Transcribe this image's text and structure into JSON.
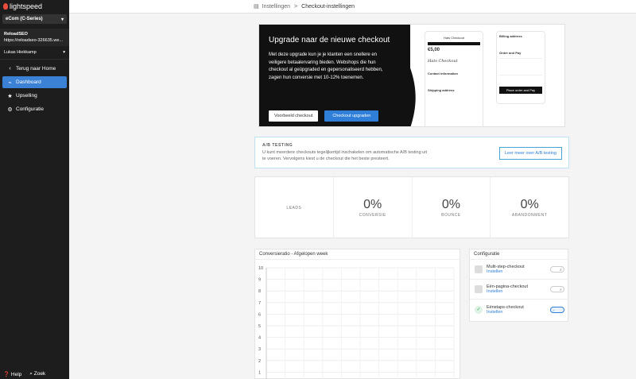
{
  "sidebar": {
    "logo_text": "lightspeed",
    "store_select": "eCom (C-Series)",
    "shop_name": "ReloadSEO",
    "shop_url": "https://reloadseo-326635.we...",
    "user_name": "Lukas Hiekkamp",
    "nav": [
      {
        "label": "Terug naar Home",
        "icon": "chevron-left"
      },
      {
        "label": "Dashboard",
        "icon": "chart"
      },
      {
        "label": "Upselling",
        "icon": "star"
      },
      {
        "label": "Configuratie",
        "icon": "gear"
      }
    ],
    "footer_help": "Help",
    "footer_search": "Zoek"
  },
  "breadcrumb": {
    "parent": "Instellingen",
    "separator": ">",
    "current": "Checkout-instellingen"
  },
  "banner": {
    "title": "Upgrade naar de nieuwe checkout",
    "text": "Met deze upgrade kun je je klanten een snellere en veiligere betaalervaring bieden. Webshops die hun checkout al geüpgraded en gepersonaliseerd hebben, zagen hun conversie met 10-12% toenemen.",
    "btn_example": "Voorbeeld checkout",
    "btn_upgrade": "Checkout upgraden",
    "phone1": {
      "header": "Hats Checkout",
      "price": "€5,00",
      "signature": "Hats Checkout",
      "contact": "Contact information",
      "shipping": "Shipping address"
    },
    "phone2": {
      "billing": "Billing address",
      "order_pay": "Order and Pay",
      "place_btn": "Place order and Pay"
    }
  },
  "ab": {
    "title": "A/B TESTING",
    "text": "U kunt meerdere checkouts tegelijkertijd inschakelen om automatische A/B testing uit te voeren. Vervolgens kiest u de checkout die het beste presteert.",
    "button": "Leer meer over A/B testing"
  },
  "stats": [
    {
      "value": "",
      "label": "LEADS"
    },
    {
      "value": "0%",
      "label": "CONVERSIE"
    },
    {
      "value": "0%",
      "label": "BOUNCE"
    },
    {
      "value": "0%",
      "label": "ABANDONMENT"
    }
  ],
  "chart_title": "Conversieratio - Afgelopen week",
  "chart_data": {
    "type": "line",
    "title": "Conversieratio - Afgelopen week",
    "xlabel": "",
    "ylabel": "",
    "ylim": [
      0,
      10
    ],
    "yticks": [
      "10",
      "9",
      "8",
      "7",
      "6",
      "5",
      "4",
      "3",
      "2",
      "1"
    ],
    "series": [],
    "grid": true
  },
  "config": {
    "title": "Configuratie",
    "items": [
      {
        "name": "Multi-step-checkout",
        "link": "Instellen",
        "enabled": false
      },
      {
        "name": "Eén-pagina-checkout",
        "link": "Instellen",
        "enabled": false
      },
      {
        "name": "Eénstaps-checkout",
        "link": "Instellen",
        "enabled": true
      }
    ]
  }
}
